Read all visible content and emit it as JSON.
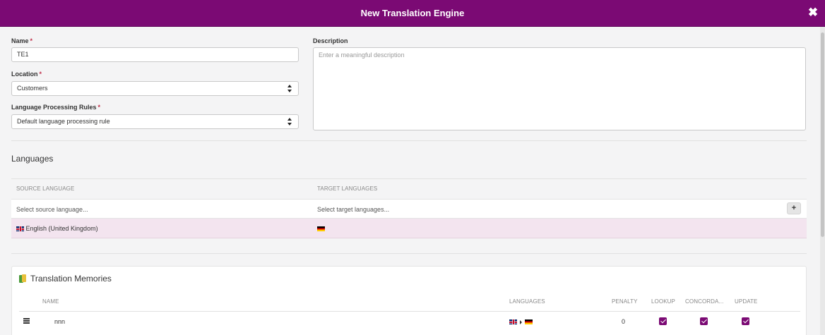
{
  "dialog": {
    "title": "New Translation Engine",
    "close_icon": "close-icon"
  },
  "form": {
    "name_label": "Name",
    "name_value": "TE1",
    "location_label": "Location",
    "location_value": "Customers",
    "rules_label": "Language Processing Rules",
    "rules_value": "Default language processing rule",
    "required_mark": "*",
    "description_label": "Description",
    "description_placeholder": "Enter a meaningful description"
  },
  "languages": {
    "title": "Languages",
    "source_header": "SOURCE LANGUAGE",
    "target_header": "TARGET LANGUAGES",
    "source_placeholder": "Select source language...",
    "target_placeholder": "Select target languages...",
    "add_label": "+",
    "selected_source": "English (United Kingdom)",
    "selected_source_flag": "flag-uk",
    "selected_target_flag": "flag-de"
  },
  "translation_memories": {
    "title": "Translation Memories",
    "columns": {
      "name": "NAME",
      "languages": "LANGUAGES",
      "penalty": "PENALTY",
      "lookup": "LOOKUP",
      "concordance": "CONCORDA...",
      "update": "UPDATE"
    },
    "rows": [
      {
        "name": "nnn",
        "source_flag": "flag-uk",
        "target_flag": "flag-de",
        "penalty": "0",
        "lookup": true,
        "concordance": true,
        "update": true
      }
    ]
  },
  "colors": {
    "accent": "#7b0a74",
    "selected_row": "#f3e4ef",
    "required": "#c0304a"
  }
}
